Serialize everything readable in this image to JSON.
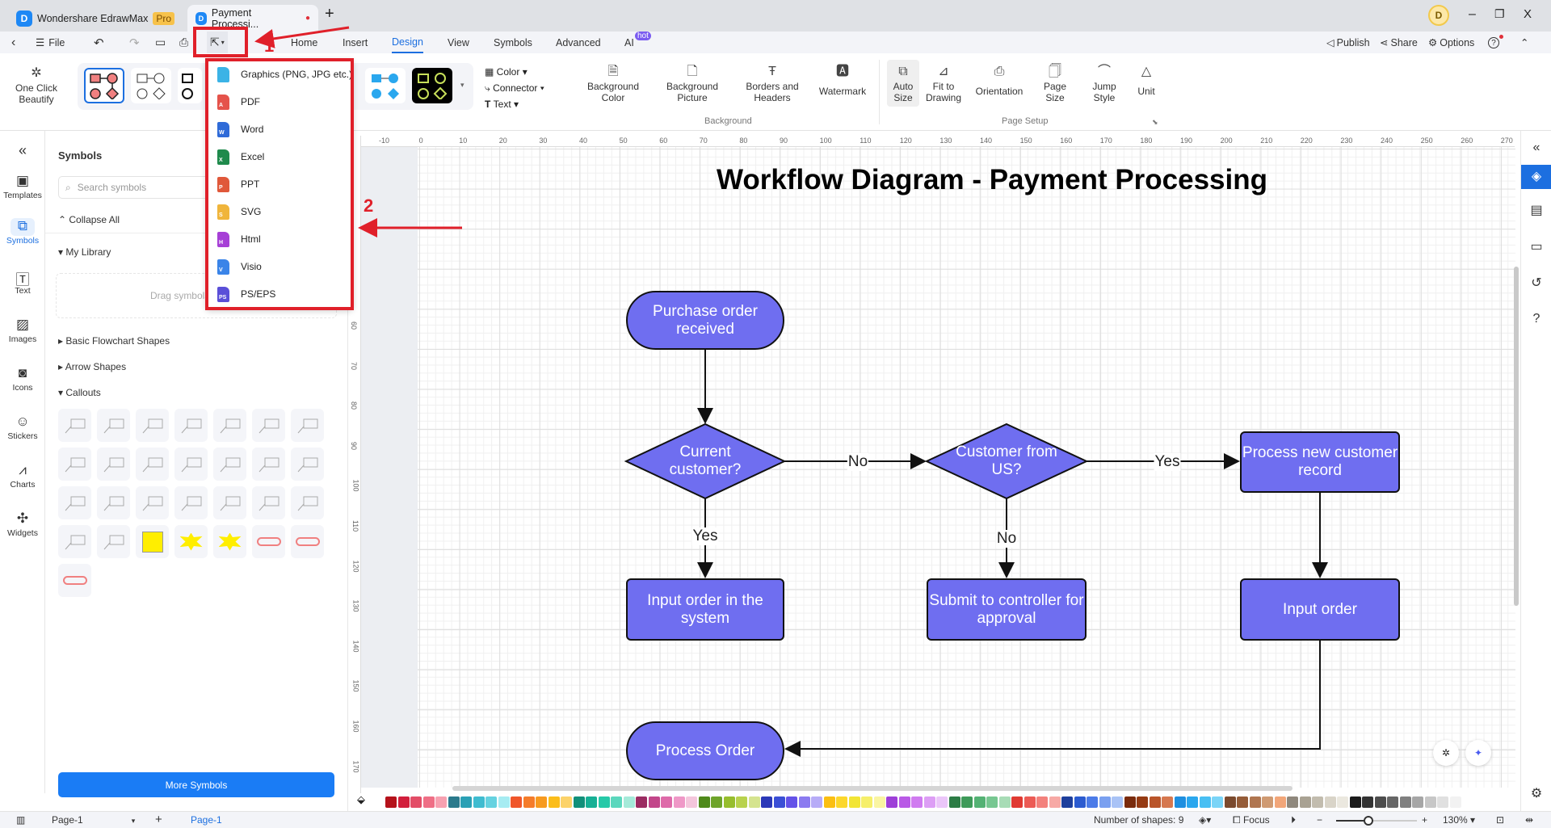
{
  "titlebar": {
    "app_name": "Wondershare EdrawMax",
    "badge": "Pro",
    "doc_tab": "Payment Processi...",
    "new_tab": "+",
    "avatar": "D",
    "minimize": "–",
    "restore": "❐",
    "close": "X"
  },
  "menu": {
    "file": "File",
    "tabs": [
      "Home",
      "Insert",
      "Design",
      "View",
      "Symbols",
      "Advanced",
      "AI"
    ],
    "active_tab": "Design",
    "ai_badge": "hot",
    "publish": "Publish",
    "share": "Share",
    "options": "Options",
    "help": "?"
  },
  "ribbon": {
    "one_click": [
      "One Click",
      "Beautify"
    ],
    "color": "Color",
    "connector": "Connector",
    "text": "Text",
    "background_items": [
      [
        "Background",
        "Color"
      ],
      [
        "Background",
        "Picture"
      ],
      [
        "Borders and",
        "Headers"
      ],
      [
        "Watermark",
        ""
      ]
    ],
    "page_setup_items": [
      [
        "Auto",
        "Size"
      ],
      [
        "Fit to",
        "Drawing"
      ],
      [
        "Orientation",
        ""
      ],
      [
        "Page",
        "Size"
      ],
      [
        "Jump",
        "Style"
      ],
      [
        "Unit",
        ""
      ]
    ],
    "group_background": "Background",
    "group_page_setup": "Page Setup"
  },
  "export_menu": {
    "items": [
      {
        "label": "Graphics (PNG, JPG etc.)",
        "icon": "image-file-icon",
        "color": "#3bb3e6",
        "letter": ""
      },
      {
        "label": "PDF",
        "icon": "pdf-file-icon",
        "color": "#e5534b",
        "letter": "A"
      },
      {
        "label": "Word",
        "icon": "word-file-icon",
        "color": "#2f6bd8",
        "letter": "W"
      },
      {
        "label": "Excel",
        "icon": "excel-file-icon",
        "color": "#1f8a4c",
        "letter": "X"
      },
      {
        "label": "PPT",
        "icon": "ppt-file-icon",
        "color": "#e0583a",
        "letter": "P"
      },
      {
        "label": "SVG",
        "icon": "svg-file-icon",
        "color": "#f0b53b",
        "letter": "S"
      },
      {
        "label": "Html",
        "icon": "html-file-icon",
        "color": "#a63fd6",
        "letter": "H"
      },
      {
        "label": "Visio",
        "icon": "visio-file-icon",
        "color": "#3a84e8",
        "letter": "V"
      },
      {
        "label": "PS/EPS",
        "icon": "ps-file-icon",
        "color": "#5a4fd8",
        "letter": "PS"
      }
    ]
  },
  "annotations": {
    "step1": "1",
    "step2": "2",
    "color": "#e0202a"
  },
  "leftbar": [
    "Templates",
    "Symbols",
    "Text",
    "Images",
    "Icons",
    "Stickers",
    "Charts",
    "Widgets"
  ],
  "panel": {
    "title": "Symbols",
    "search_placeholder": "Search symbols",
    "collapse_all": "Collapse All",
    "my_library": "My Library",
    "drop_hint": "Drag symbols here to",
    "sections": [
      "Basic Flowchart Shapes",
      "Arrow Shapes",
      "Callouts"
    ],
    "more_symbols": "More Symbols"
  },
  "rulers": {
    "horizontal": [
      "-10",
      "0",
      "10",
      "20",
      "30",
      "40",
      "50",
      "60",
      "70",
      "80",
      "90",
      "100",
      "110",
      "120",
      "130",
      "140",
      "150",
      "160",
      "170",
      "180",
      "190",
      "200",
      "210",
      "220",
      "230",
      "240",
      "250",
      "260",
      "270"
    ],
    "vertical": [
      "60",
      "70",
      "80",
      "90",
      "100",
      "110",
      "120",
      "130",
      "140",
      "150",
      "160",
      "170"
    ]
  },
  "diagram": {
    "title": "Workflow Diagram - Payment Processing",
    "fill": "#6f6ef0",
    "nodes": {
      "start": "Purchase order received",
      "current": "Current customer?",
      "us": "Customer from US?",
      "new_record": "Process new customer record",
      "input_system": "Input order in the system",
      "submit": "Submit to controller for approval",
      "input_order": "Input order",
      "process_order": "Process Order"
    },
    "edge_labels": {
      "current_no": "No",
      "us_yes": "Yes",
      "current_yes": "Yes",
      "us_no": "No"
    }
  },
  "palette": [
    "#b5121b",
    "#d21f3c",
    "#e34d67",
    "#ef6f86",
    "#f7a1b1",
    "#2b7a8c",
    "#2aa0b5",
    "#3fbcd0",
    "#65d2e0",
    "#a6ecf2",
    "#f0562a",
    "#f57c2a",
    "#f79a1f",
    "#fbbd1a",
    "#fcd36a",
    "#11907a",
    "#16b095",
    "#26c9a8",
    "#5bd7bd",
    "#a5ead9",
    "#9b2c62",
    "#c2468a",
    "#de6aa9",
    "#ef98c7",
    "#f4c6dc",
    "#4f8a1b",
    "#6ea42a",
    "#97be2d",
    "#b8d24d",
    "#d5e48f",
    "#2b38b8",
    "#3b4fd6",
    "#6452e8",
    "#8b7bf0",
    "#b7acf7",
    "#fbbf12",
    "#fcd72b",
    "#f2e535",
    "#f6ef6a",
    "#faf5a2",
    "#9e3fd8",
    "#b95ae6",
    "#d07bf0",
    "#dd9ef5",
    "#ebc6f9",
    "#2d7d46",
    "#3e9a59",
    "#54b274",
    "#77c791",
    "#a8dcb6",
    "#e03a32",
    "#ec5b55",
    "#f3817c",
    "#f7a9a5",
    "#1e3f9c",
    "#2b5bd0",
    "#4b7be8",
    "#7aa0f0",
    "#a9c3f6",
    "#7a2b0c",
    "#953a12",
    "#b9552a",
    "#d6784f",
    "#1e8fe0",
    "#2aa7ee",
    "#48bff3",
    "#7ad4f7",
    "#7b4a2e",
    "#955c38",
    "#b07650",
    "#cf9a72",
    "#f2a679",
    "#8f887d",
    "#a9a293",
    "#c2bcae",
    "#d9d4c8",
    "#ebe8df",
    "#1b1b1b",
    "#333333",
    "#4d4d4d",
    "#666666",
    "#808080",
    "#a6a6a6",
    "#c7c7c7",
    "#e0e0e0",
    "#f2f2f2"
  ],
  "status": {
    "page_select": "Page-1",
    "add_page": "+",
    "page_tab": "Page-1",
    "shapes": "Number of shapes: 9",
    "focus": "Focus",
    "zoom_out": "−",
    "zoom_in": "+",
    "zoom": "130%",
    "zoom_level_percent": 130
  }
}
